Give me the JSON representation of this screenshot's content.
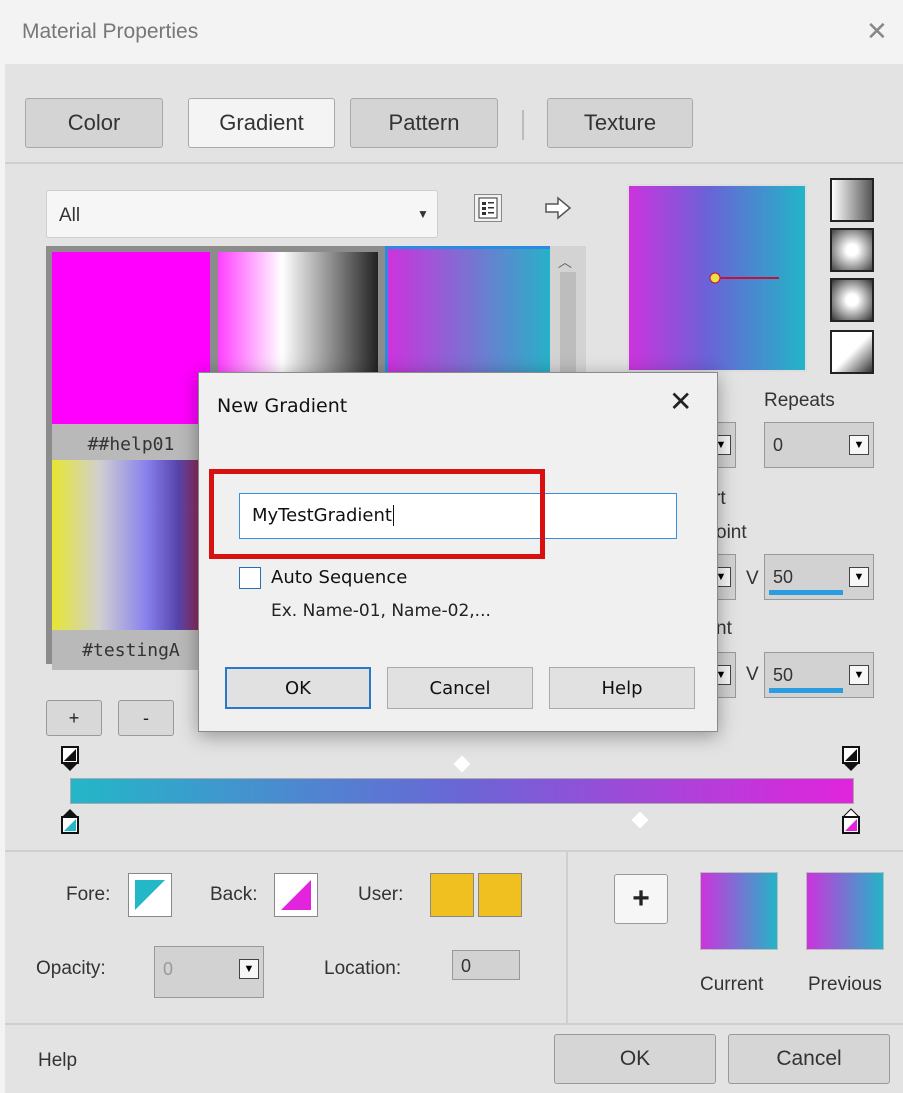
{
  "window": {
    "title": "Material Properties"
  },
  "tabs": [
    {
      "label": "Color"
    },
    {
      "label": "Gradient"
    },
    {
      "label": "Pattern"
    },
    {
      "label": "Texture"
    }
  ],
  "gallery": {
    "category_value": "All",
    "swatches": [
      {
        "label": "##help01"
      },
      {
        "label": "#testingA"
      }
    ],
    "add_label": "+",
    "remove_label": "-"
  },
  "settings": {
    "repeats_label": "Repeats",
    "repeats_value": "0",
    "center_label_fragment": "rt",
    "point_label_fragment": "oint",
    "focal_label_fragment": "nt",
    "v_label": "V",
    "center_v_value": "50",
    "focal_v_value": "50"
  },
  "lower": {
    "fore_label": "Fore:",
    "back_label": "Back:",
    "user_label": "User:",
    "opacity_label": "Opacity:",
    "opacity_value": "0",
    "location_label": "Location:",
    "location_value": "0",
    "current_label": "Current",
    "previous_label": "Previous",
    "add_label": "+"
  },
  "footer": {
    "help_label": "Help",
    "ok_label": "OK",
    "cancel_label": "Cancel"
  },
  "modal": {
    "title": "New Gradient",
    "name_value": "MyTestGradient",
    "auto_sequence_label": "Auto Sequence",
    "example_text": "Ex. Name-01, Name-02,...",
    "ok_label": "OK",
    "cancel_label": "Cancel",
    "help_label": "Help"
  },
  "colors": {
    "accent": "#2a79c9",
    "highlight": "#d91010",
    "user_color": "#f0c020",
    "gradient_start": "#23b7c8",
    "gradient_end": "#e224dc"
  }
}
